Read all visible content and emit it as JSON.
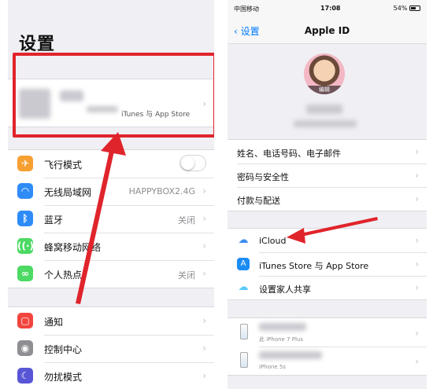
{
  "left": {
    "title": "设置",
    "profile": {
      "subtitle": "iTunes 与 App Store"
    },
    "group1": [
      {
        "label": "飞行模式",
        "icon": "airplane-icon",
        "color": "#f7a032",
        "value": "",
        "toggle": true
      },
      {
        "label": "无线局域网",
        "icon": "wifi-icon",
        "color": "#2f8cf7",
        "value": "HAPPYBOX2.4G"
      },
      {
        "label": "蓝牙",
        "icon": "bluetooth-icon",
        "color": "#2f8cf7",
        "value": "关闭"
      },
      {
        "label": "蜂窝移动网络",
        "icon": "cellular-icon",
        "color": "#4cd964",
        "value": ""
      },
      {
        "label": "个人热点",
        "icon": "hotspot-icon",
        "color": "#4cd964",
        "value": "关闭"
      }
    ],
    "group2": [
      {
        "label": "通知",
        "icon": "notifications-icon",
        "color": "#f2453d"
      },
      {
        "label": "控制中心",
        "icon": "control-center-icon",
        "color": "#8e8e93"
      },
      {
        "label": "勿扰模式",
        "icon": "do-not-disturb-icon",
        "color": "#5856d6"
      }
    ]
  },
  "right": {
    "status": {
      "carrier": "中国移动",
      "time": "17:08",
      "battery": "54%"
    },
    "nav": {
      "back": "设置",
      "title": "Apple ID"
    },
    "avatar_edit": "编辑",
    "group1": [
      "姓名、电话号码、电子邮件",
      "密码与安全性",
      "付款与配送"
    ],
    "group2": [
      {
        "label": "iCloud",
        "icon": "icloud-icon",
        "color": "#3d8ef0"
      },
      {
        "label": "iTunes Store 与 App Store",
        "icon": "app-store-icon",
        "color": "#1b8cf5"
      },
      {
        "label": "设置家人共享",
        "icon": "family-sharing-icon",
        "color": "#5ac8fa"
      }
    ],
    "devices": [
      {
        "sub": "此 iPhone 7 Plus"
      },
      {
        "sub": "iPhone 5s"
      }
    ]
  }
}
